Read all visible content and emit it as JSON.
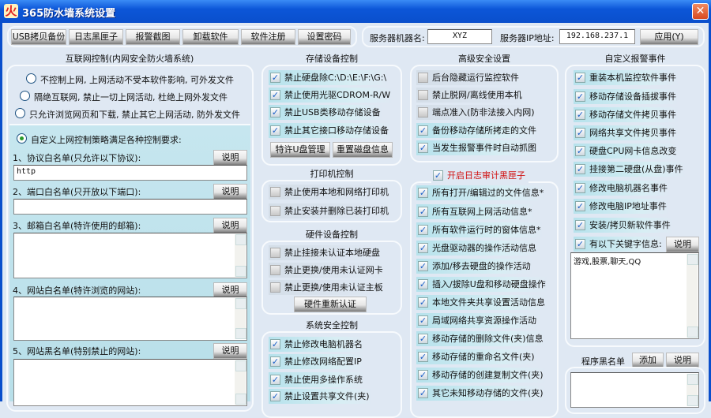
{
  "window": {
    "title": "365防水墙系统设置",
    "icon": "365-logo-icon",
    "close": "✕"
  },
  "toolbar": {
    "buttons": [
      "USB拷贝备份",
      "日志黑匣子",
      "报警截图",
      "卸载软件",
      "软件注册",
      "设置密码"
    ],
    "server_name_label": "服务器机器名:",
    "server_name": "XYZ",
    "server_ip_label": "服务器IP地址:",
    "server_ip": "192.168.237.1",
    "apply": "应用(Y)"
  },
  "internet": {
    "title": "互联网控制(内网安全防火墙系统)",
    "options": [
      "不控制上网, 上网活动不受本软件影响, 可外发文件",
      "隔绝互联网, 禁止一切上网活动, 杜绝上网外发文件",
      "只允许浏览网页和下载, 禁止其它上网活动, 防外发文件",
      "自定义上网控制策略满足各种控制要求:"
    ],
    "selected": 3,
    "lists": [
      {
        "label": "1、协议白名单(只允许以下协议):",
        "value": "http"
      },
      {
        "label": "2、端口白名单(只开放以下端口):",
        "value": ""
      },
      {
        "label": "3、邮箱白名单(特许使用的邮箱):",
        "value": ""
      },
      {
        "label": "4、网站白名单(特许浏览的网站):",
        "value": ""
      },
      {
        "label": "5、网站黑名单(特别禁止的网站):",
        "value": ""
      }
    ],
    "explain": "说明"
  },
  "storage": {
    "title": "存储设备控制",
    "items": [
      {
        "label": "禁止硬盘除C:\\D:\\E:\\F:\\G:\\",
        "checked": true
      },
      {
        "label": "禁止使用光驱CDROM-R/W",
        "checked": true
      },
      {
        "label": "禁止USB类移动存储设备",
        "checked": true
      },
      {
        "label": "禁止其它接口移动存储设备",
        "checked": true
      }
    ],
    "btn1": "特许U盘管理",
    "btn2": "重置磁盘信息"
  },
  "printer": {
    "title": "打印机控制",
    "items": [
      {
        "label": "禁止使用本地和网络打印机",
        "checked": false
      },
      {
        "label": "禁止安装并删除已装打印机",
        "checked": false
      }
    ]
  },
  "hardware": {
    "title": "硬件设备控制",
    "items": [
      {
        "label": "禁止挂接未认证本地硬盘",
        "checked": false
      },
      {
        "label": "禁止更换/使用未认证网卡",
        "checked": false
      },
      {
        "label": "禁止更换/使用未认证主板",
        "checked": false
      }
    ],
    "btn": "硬件重新认证"
  },
  "system": {
    "title": "系统安全控制",
    "items": [
      {
        "label": "禁止修改电脑机器名",
        "checked": true
      },
      {
        "label": "禁止修改网络配置IP",
        "checked": true
      },
      {
        "label": "禁止使用多操作系统",
        "checked": true
      },
      {
        "label": "禁止设置共享文件(夹)",
        "checked": true
      }
    ]
  },
  "advanced": {
    "title": "高级安全设置",
    "items": [
      {
        "label": "后台隐藏运行监控软件",
        "checked": false
      },
      {
        "label": "禁止脱网/离线使用本机",
        "checked": false
      },
      {
        "label": "端点准入(防非法接入内网)",
        "checked": false
      },
      {
        "label": "备份移动存储所拷走的文件",
        "checked": true
      },
      {
        "label": "当发生报警事件时自动抓图",
        "checked": true
      }
    ]
  },
  "audit": {
    "title": "开启日志审计黑匣子",
    "checked": true,
    "title_color": "#d01010",
    "items": [
      {
        "label": "所有打开/编辑过的文件信息*",
        "checked": true
      },
      {
        "label": "所有互联网上网活动信息*",
        "checked": true
      },
      {
        "label": "所有软件运行时的窗体信息*",
        "checked": true
      },
      {
        "label": "光盘驱动器的操作活动信息",
        "checked": true
      },
      {
        "label": "添加/移去硬盘的操作活动",
        "checked": true
      },
      {
        "label": "插入/拔除U盘和移动硬盘操作",
        "checked": true
      },
      {
        "label": "本地文件夹共享设置活动信息",
        "checked": true
      },
      {
        "label": "局域网络共享资源操作活动",
        "checked": true
      },
      {
        "label": "移动存储的删除文件(夹)信息",
        "checked": true
      },
      {
        "label": "移动存储的重命名文件(夹)",
        "checked": true
      },
      {
        "label": "移动存储的创建复制文件(夹)",
        "checked": true
      },
      {
        "label": "其它未知移动存储的文件(夹)",
        "checked": true
      }
    ]
  },
  "alarm": {
    "title": "自定义报警事件",
    "items": [
      {
        "label": "重装本机监控软件事件",
        "checked": true
      },
      {
        "label": "移动存储设备插拔事件",
        "checked": true
      },
      {
        "label": "移动存储文件拷贝事件",
        "checked": true
      },
      {
        "label": "网络共享文件拷贝事件",
        "checked": true
      },
      {
        "label": "硬盘CPU网卡信息改变",
        "checked": true
      },
      {
        "label": "挂接第二硬盘(从盘)事件",
        "checked": true
      },
      {
        "label": "修改电脑机器名事件",
        "checked": true
      },
      {
        "label": "修改电脑IP地址事件",
        "checked": true
      },
      {
        "label": "安装/拷贝新软件事件",
        "checked": true
      },
      {
        "label": "有以下关键字信息:",
        "checked": true
      }
    ],
    "explain": "说明",
    "keywords": "游戏,股票,聊天,QQ"
  },
  "blacklist": {
    "title": "程序黑名单",
    "add": "添加",
    "explain": "说明",
    "value": ""
  }
}
